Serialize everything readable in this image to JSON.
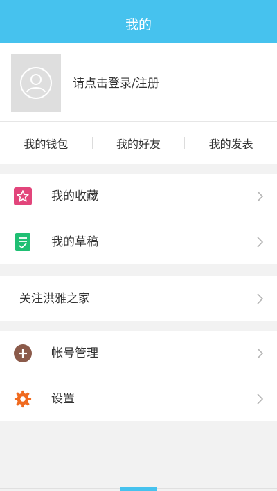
{
  "header": {
    "title": "我的"
  },
  "profile": {
    "login_text": "请点击登录/注册"
  },
  "quick": {
    "wallet": "我的钱包",
    "friends": "我的好友",
    "posts": "我的发表"
  },
  "menu": {
    "favorites": "我的收藏",
    "drafts": "我的草稿",
    "follow": "关注洪雅之家",
    "account": "帐号管理",
    "settings": "设置"
  },
  "colors": {
    "accent": "#46c2ee",
    "favorites_icon": "#e2457b",
    "drafts_icon": "#1fbf73",
    "account_icon": "#8b5a4a",
    "settings_icon": "#f06a1f"
  }
}
